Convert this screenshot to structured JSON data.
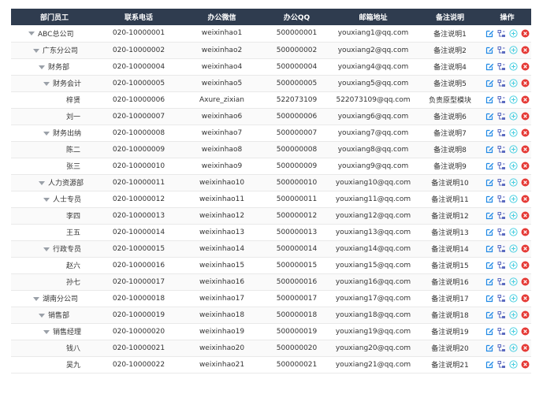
{
  "columns": [
    "部门员工",
    "联系电话",
    "办公微信",
    "办公QQ",
    "邮箱地址",
    "备注说明",
    "操作"
  ],
  "colors": {
    "header_bg": "#2f3c4f",
    "edit": "#1e88e5",
    "move": "#5c6bc0",
    "add": "#4dd0e1",
    "delete": "#e53935"
  },
  "icons": {
    "edit": "edit-icon",
    "move": "move-icon",
    "add": "add-circle-icon",
    "delete": "delete-circle-icon",
    "expand": "caret-down-icon"
  },
  "rows": [
    {
      "name": "ABC总公司",
      "depth": 1,
      "expandable": true,
      "phone": "020-10000001",
      "wechat": "weixinhao1",
      "qq": "500000001",
      "email": "youxiang1@qq.com",
      "note": "备注说明1"
    },
    {
      "name": "广东分公司",
      "depth": 2,
      "expandable": true,
      "phone": "020-10000002",
      "wechat": "weixinhao2",
      "qq": "500000002",
      "email": "youxiang2@qq.com",
      "note": "备注说明2"
    },
    {
      "name": "财务部",
      "depth": 3,
      "expandable": true,
      "phone": "020-10000004",
      "wechat": "weixinhao4",
      "qq": "500000004",
      "email": "youxiang4@qq.com",
      "note": "备注说明4"
    },
    {
      "name": "财务会计",
      "depth": 4,
      "expandable": true,
      "phone": "020-10000005",
      "wechat": "weixinhao5",
      "qq": "500000005",
      "email": "youxiang5@qq.com",
      "note": "备注说明5"
    },
    {
      "name": "梓贤",
      "depth": 5,
      "expandable": false,
      "phone": "020-10000006",
      "wechat": "Axure_zixian",
      "qq": "522073109",
      "email": "522073109@qq.com",
      "note": "负责原型模块"
    },
    {
      "name": "刘一",
      "depth": 5,
      "expandable": false,
      "phone": "020-10000007",
      "wechat": "weixinhao6",
      "qq": "500000006",
      "email": "youxiang6@qq.com",
      "note": "备注说明6"
    },
    {
      "name": "财务出纳",
      "depth": 4,
      "expandable": true,
      "phone": "020-10000008",
      "wechat": "weixinhao7",
      "qq": "500000007",
      "email": "youxiang7@qq.com",
      "note": "备注说明7"
    },
    {
      "name": "陈二",
      "depth": 5,
      "expandable": false,
      "phone": "020-10000009",
      "wechat": "weixinhao8",
      "qq": "500000008",
      "email": "youxiang8@qq.com",
      "note": "备注说明8"
    },
    {
      "name": "张三",
      "depth": 5,
      "expandable": false,
      "phone": "020-10000010",
      "wechat": "weixinhao9",
      "qq": "500000009",
      "email": "youxiang9@qq.com",
      "note": "备注说明9"
    },
    {
      "name": "人力资源部",
      "depth": 3,
      "expandable": true,
      "phone": "020-10000011",
      "wechat": "weixinhao10",
      "qq": "500000010",
      "email": "youxiang10@qq.com",
      "note": "备注说明10"
    },
    {
      "name": "人士专员",
      "depth": 4,
      "expandable": true,
      "phone": "020-10000012",
      "wechat": "weixinhao11",
      "qq": "500000011",
      "email": "youxiang11@qq.com",
      "note": "备注说明11"
    },
    {
      "name": "李四",
      "depth": 5,
      "expandable": false,
      "phone": "020-10000013",
      "wechat": "weixinhao12",
      "qq": "500000012",
      "email": "youxiang12@qq.com",
      "note": "备注说明12"
    },
    {
      "name": "王五",
      "depth": 5,
      "expandable": false,
      "phone": "020-10000014",
      "wechat": "weixinhao13",
      "qq": "500000013",
      "email": "youxiang13@qq.com",
      "note": "备注说明13"
    },
    {
      "name": "行政专员",
      "depth": 4,
      "expandable": true,
      "phone": "020-10000015",
      "wechat": "weixinhao14",
      "qq": "500000014",
      "email": "youxiang14@qq.com",
      "note": "备注说明14"
    },
    {
      "name": "赵六",
      "depth": 5,
      "expandable": false,
      "phone": "020-10000016",
      "wechat": "weixinhao15",
      "qq": "500000015",
      "email": "youxiang15@qq.com",
      "note": "备注说明15"
    },
    {
      "name": "孙七",
      "depth": 5,
      "expandable": false,
      "phone": "020-10000017",
      "wechat": "weixinhao16",
      "qq": "500000016",
      "email": "youxiang16@qq.com",
      "note": "备注说明16"
    },
    {
      "name": "湖南分公司",
      "depth": 2,
      "expandable": true,
      "phone": "020-10000018",
      "wechat": "weixinhao17",
      "qq": "500000017",
      "email": "youxiang17@qq.com",
      "note": "备注说明17"
    },
    {
      "name": "销售部",
      "depth": 3,
      "expandable": true,
      "phone": "020-10000019",
      "wechat": "weixinhao18",
      "qq": "500000018",
      "email": "youxiang18@qq.com",
      "note": "备注说明18"
    },
    {
      "name": "销售经理",
      "depth": 4,
      "expandable": true,
      "phone": "020-10000020",
      "wechat": "weixinhao19",
      "qq": "500000019",
      "email": "youxiang19@qq.com",
      "note": "备注说明19"
    },
    {
      "name": "钱八",
      "depth": 5,
      "expandable": false,
      "phone": "020-10000021",
      "wechat": "weixinhao20",
      "qq": "500000020",
      "email": "youxiang20@qq.com",
      "note": "备注说明20"
    },
    {
      "name": "吴九",
      "depth": 5,
      "expandable": false,
      "phone": "020-10000022",
      "wechat": "weixinhao21",
      "qq": "500000021",
      "email": "youxiang21@qq.com",
      "note": "备注说明21"
    }
  ]
}
